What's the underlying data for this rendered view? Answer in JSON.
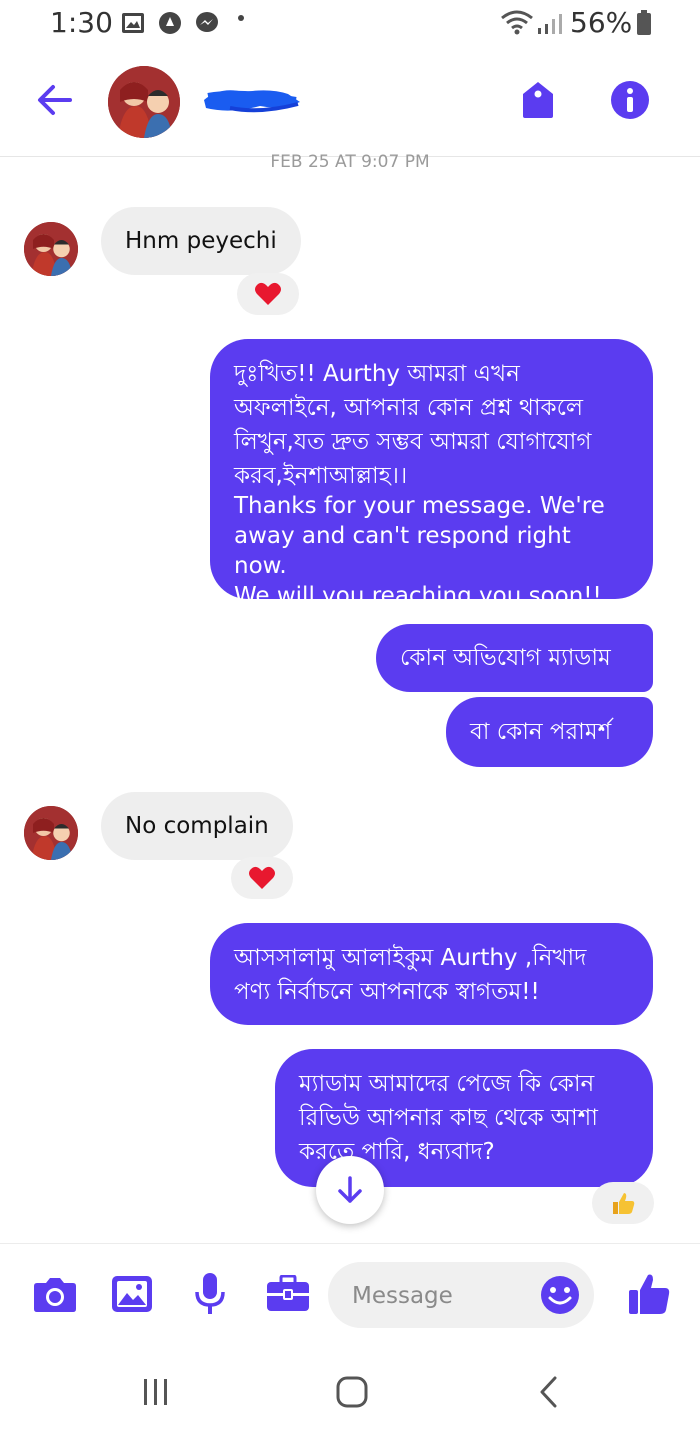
{
  "status_bar": {
    "time": "1:30",
    "battery": "56%",
    "icons": [
      "gallery-icon",
      "circle-dot-icon",
      "messenger-icon",
      "wifi-icon",
      "signal-icon",
      "battery-icon"
    ]
  },
  "header": {
    "icons": [
      "back-arrow-icon",
      "tag-icon",
      "info-icon"
    ]
  },
  "conversation": {
    "timestamp": "FEB 25 AT 9:07 PM",
    "messages": [
      {
        "side": "in",
        "text": "Hnm peyechi",
        "reaction": "heart"
      },
      {
        "side": "out",
        "lines": [
          "দুঃখিত!! Aurthy আমরা এখন",
          "অফলাইনে, আপনার কোন প্রশ্ন থাকলে",
          "লিখুন,যত দ্রুত সম্ভব আমরা যোগাযোগ",
          "করব,ইনশাআল্লাহ।।",
          "Thanks for your message. We're",
          "away and can't respond right now.",
          "We will  you reaching you soon!!"
        ]
      },
      {
        "side": "out",
        "text": "কোন অভিযোগ ম্যাডাম"
      },
      {
        "side": "out",
        "text": "বা কোন পরামর্শ"
      },
      {
        "side": "in",
        "text": "No complain",
        "reaction": "heart"
      },
      {
        "side": "out",
        "lines": [
          "আসসালামু  আলাইকুম Aurthy ,নিখাদ",
          "পণ্য নির্বাচনে আপনাকে স্বাগতম!!"
        ]
      },
      {
        "side": "out",
        "lines": [
          "ম্যাডাম আমাদের পেজে কি কোন",
          "রিভিউ আপনার কাছ থেকে আশা",
          "করতে পারি, ধন্যবাদ?"
        ],
        "reaction": "thumbs-up"
      }
    ]
  },
  "composer": {
    "placeholder": "Message",
    "icons": [
      "camera-icon",
      "image-icon",
      "microphone-icon",
      "briefcase-icon",
      "emoji-icon",
      "like-icon"
    ]
  },
  "colors": {
    "accent": "#5b3cf0",
    "incoming_bubble": "#eeeeee",
    "heart": "#e8182f"
  }
}
